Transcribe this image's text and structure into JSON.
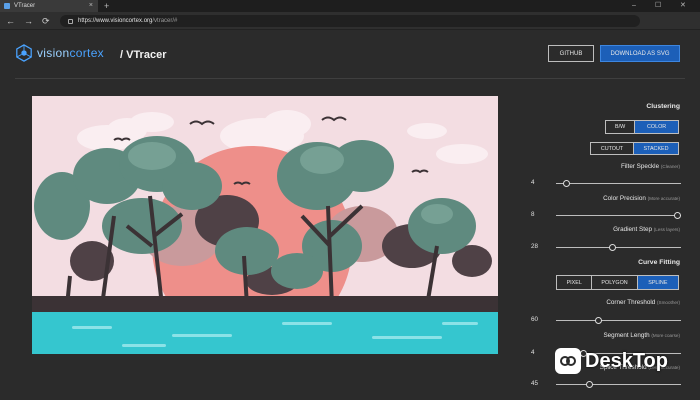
{
  "browser": {
    "tab_title": "VTracer",
    "new_tab_symbol": "+",
    "close_tab_symbol": "×",
    "url_host": "https://www.visioncortex.org",
    "url_path": "/vtracer/#",
    "window_controls": [
      "–",
      "☐",
      "✕"
    ],
    "nav": {
      "back": "←",
      "forward": "→",
      "refresh": "⟳",
      "home": "⌂"
    }
  },
  "header": {
    "logo_text_a": "vision",
    "logo_text_b": "cortex",
    "title": "/ VTracer",
    "github_label": "GITHUB",
    "download_label": "DOWNLOAD AS SVG"
  },
  "panel": {
    "clustering": {
      "heading": "Clustering",
      "color_mode": {
        "options": [
          "B/W",
          "COLOR"
        ],
        "selected": "COLOR"
      },
      "hierarchical": {
        "options": [
          "CUTOUT",
          "STACKED"
        ],
        "selected": "STACKED"
      }
    },
    "filter_speckle": {
      "label": "Filter Speckle",
      "hint": "(Cleaner)",
      "value": "4",
      "level": 0.06
    },
    "color_precision": {
      "label": "Color Precision",
      "hint": "(More accurate)",
      "value": "8",
      "level": 1.0
    },
    "gradient_step": {
      "label": "Gradient Step",
      "hint": "(Less layers)",
      "value": "28",
      "level": 0.45
    },
    "curve_fitting": {
      "heading": "Curve Fitting",
      "mode": {
        "options": [
          "PIXEL",
          "POLYGON",
          "SPLINE"
        ],
        "selected": "SPLINE"
      }
    },
    "corner_threshold": {
      "label": "Corner Threshold",
      "hint": "(Smoother)",
      "value": "60",
      "level": 0.33
    },
    "segment_length": {
      "label": "Segment Length",
      "hint": "(More coarse)",
      "value": "4",
      "level": 0.2
    },
    "splice_threshold": {
      "label": "Splice Threshold",
      "hint": "(Less accurate)",
      "value": "45",
      "level": 0.25
    }
  },
  "watermark": {
    "text": "DeskTop"
  },
  "colors": {
    "accent": "#1c5fb8",
    "sky": "#f3dde2",
    "sun": "#ee8f8a",
    "tree_green": "#5f8a7f",
    "tree_dark": "#4f4146",
    "water": "#35c6cf",
    "ground": "#3b3235"
  }
}
